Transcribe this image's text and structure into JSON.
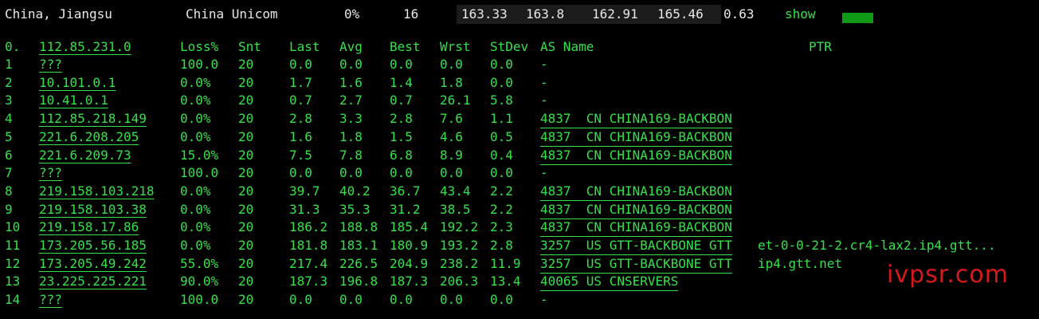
{
  "summary": {
    "location": "China, Jiangsu",
    "isp": "China Unicom",
    "loss": "0%",
    "snt": "16",
    "last": "163.33",
    "avg": "163.8",
    "best": "162.91",
    "wrst": "165.46",
    "stdev": "0.63",
    "show_label": "show"
  },
  "headers": {
    "hop": "0.",
    "host": "112.85.231.0",
    "loss": "Loss%",
    "snt": "Snt",
    "last": "Last",
    "avg": "Avg",
    "best": "Best",
    "wrst": "Wrst",
    "stdev": "StDev",
    "as": "AS Name",
    "ptr": "PTR"
  },
  "hops": [
    {
      "hop": "1",
      "host": "???",
      "loss": "100.0",
      "snt": "20",
      "last": "0.0",
      "avg": "0.0",
      "best": "0.0",
      "wrst": "0.0",
      "stdev": "0.0",
      "as": "-",
      "ptr": ""
    },
    {
      "hop": "2",
      "host": "10.101.0.1",
      "loss": "0.0%",
      "snt": "20",
      "last": "1.7",
      "avg": "1.6",
      "best": "1.4",
      "wrst": "1.8",
      "stdev": "0.0",
      "as": "-",
      "ptr": ""
    },
    {
      "hop": "3",
      "host": "10.41.0.1",
      "loss": "0.0%",
      "snt": "20",
      "last": "0.7",
      "avg": "2.7",
      "best": "0.7",
      "wrst": "26.1",
      "stdev": "5.8",
      "as": "-",
      "ptr": ""
    },
    {
      "hop": "4",
      "host": "112.85.218.149",
      "loss": "0.0%",
      "snt": "20",
      "last": "2.8",
      "avg": "3.3",
      "best": "2.8",
      "wrst": "7.6",
      "stdev": "1.1",
      "as": "4837  CN CHINA169-BACKBON",
      "ptr": ""
    },
    {
      "hop": "5",
      "host": "221.6.208.205",
      "loss": "0.0%",
      "snt": "20",
      "last": "1.6",
      "avg": "1.8",
      "best": "1.5",
      "wrst": "4.6",
      "stdev": "0.5",
      "as": "4837  CN CHINA169-BACKBON",
      "ptr": ""
    },
    {
      "hop": "6",
      "host": "221.6.209.73",
      "loss": "15.0%",
      "snt": "20",
      "last": "7.5",
      "avg": "7.8",
      "best": "6.8",
      "wrst": "8.9",
      "stdev": "0.4",
      "as": "4837  CN CHINA169-BACKBON",
      "ptr": ""
    },
    {
      "hop": "7",
      "host": "???",
      "loss": "100.0",
      "snt": "20",
      "last": "0.0",
      "avg": "0.0",
      "best": "0.0",
      "wrst": "0.0",
      "stdev": "0.0",
      "as": "-",
      "ptr": ""
    },
    {
      "hop": "8",
      "host": "219.158.103.218",
      "loss": "0.0%",
      "snt": "20",
      "last": "39.7",
      "avg": "40.2",
      "best": "36.7",
      "wrst": "43.4",
      "stdev": "2.2",
      "as": "4837  CN CHINA169-BACKBON",
      "ptr": ""
    },
    {
      "hop": "9",
      "host": "219.158.103.38",
      "loss": "0.0%",
      "snt": "20",
      "last": "31.3",
      "avg": "35.3",
      "best": "31.2",
      "wrst": "38.5",
      "stdev": "2.2",
      "as": "4837  CN CHINA169-BACKBON",
      "ptr": ""
    },
    {
      "hop": "10",
      "host": "219.158.17.86",
      "loss": "0.0%",
      "snt": "20",
      "last": "186.2",
      "avg": "188.8",
      "best": "185.4",
      "wrst": "192.2",
      "stdev": "2.3",
      "as": "4837  CN CHINA169-BACKBON",
      "ptr": ""
    },
    {
      "hop": "11",
      "host": "173.205.56.185",
      "loss": "0.0%",
      "snt": "20",
      "last": "181.8",
      "avg": "183.1",
      "best": "180.9",
      "wrst": "193.2",
      "stdev": "2.8",
      "as": "3257  US GTT-BACKBONE GTT",
      "ptr": "et-0-0-21-2.cr4-lax2.ip4.gtt..."
    },
    {
      "hop": "12",
      "host": "173.205.49.242",
      "loss": "55.0%",
      "snt": "20",
      "last": "217.4",
      "avg": "226.5",
      "best": "204.9",
      "wrst": "238.2",
      "stdev": "11.9",
      "as": "3257  US GTT-BACKBONE GTT",
      "ptr": "ip4.gtt.net"
    },
    {
      "hop": "13",
      "host": "23.225.225.221",
      "loss": "90.0%",
      "snt": "20",
      "last": "187.3",
      "avg": "196.8",
      "best": "187.3",
      "wrst": "206.3",
      "stdev": "13.4",
      "as": "40065 US CNSERVERS",
      "ptr": ""
    },
    {
      "hop": "14",
      "host": "???",
      "loss": "100.0",
      "snt": "20",
      "last": "0.0",
      "avg": "0.0",
      "best": "0.0",
      "wrst": "0.0",
      "stdev": "0.0",
      "as": "-",
      "ptr": ""
    }
  ],
  "watermark": "ivpsr.com",
  "colors": {
    "text_green": "#36e04a",
    "summary_text": "#e8e8e8",
    "bar_green": "#0f9a18",
    "watermark_red": "#d61a1a",
    "background": "#000000"
  }
}
